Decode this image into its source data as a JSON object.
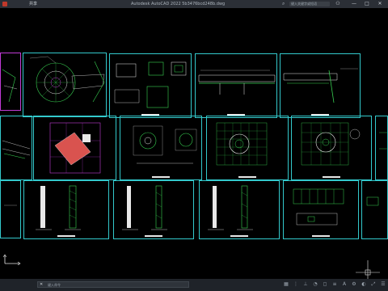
{
  "app": {
    "title": "Autodesk AutoCAD 2022    5b3476bcd248b.dwg",
    "menu_label": "共享",
    "search_placeholder": "键入关键字或短语",
    "minimize": "—",
    "maximize": "□",
    "close": "✕"
  },
  "command": {
    "placeholder": "键入命令",
    "close_glyph": "✕"
  },
  "icons": {
    "search": "search-icon",
    "user": "user-icon",
    "ucs": "ucs-icon",
    "crosshair": "crosshair-icon"
  },
  "colors": {
    "sheet_border": "#33c9cc",
    "drawing_green": "#39d353",
    "accent_magenta": "#c13bd6",
    "accent_red": "#d9534f"
  }
}
